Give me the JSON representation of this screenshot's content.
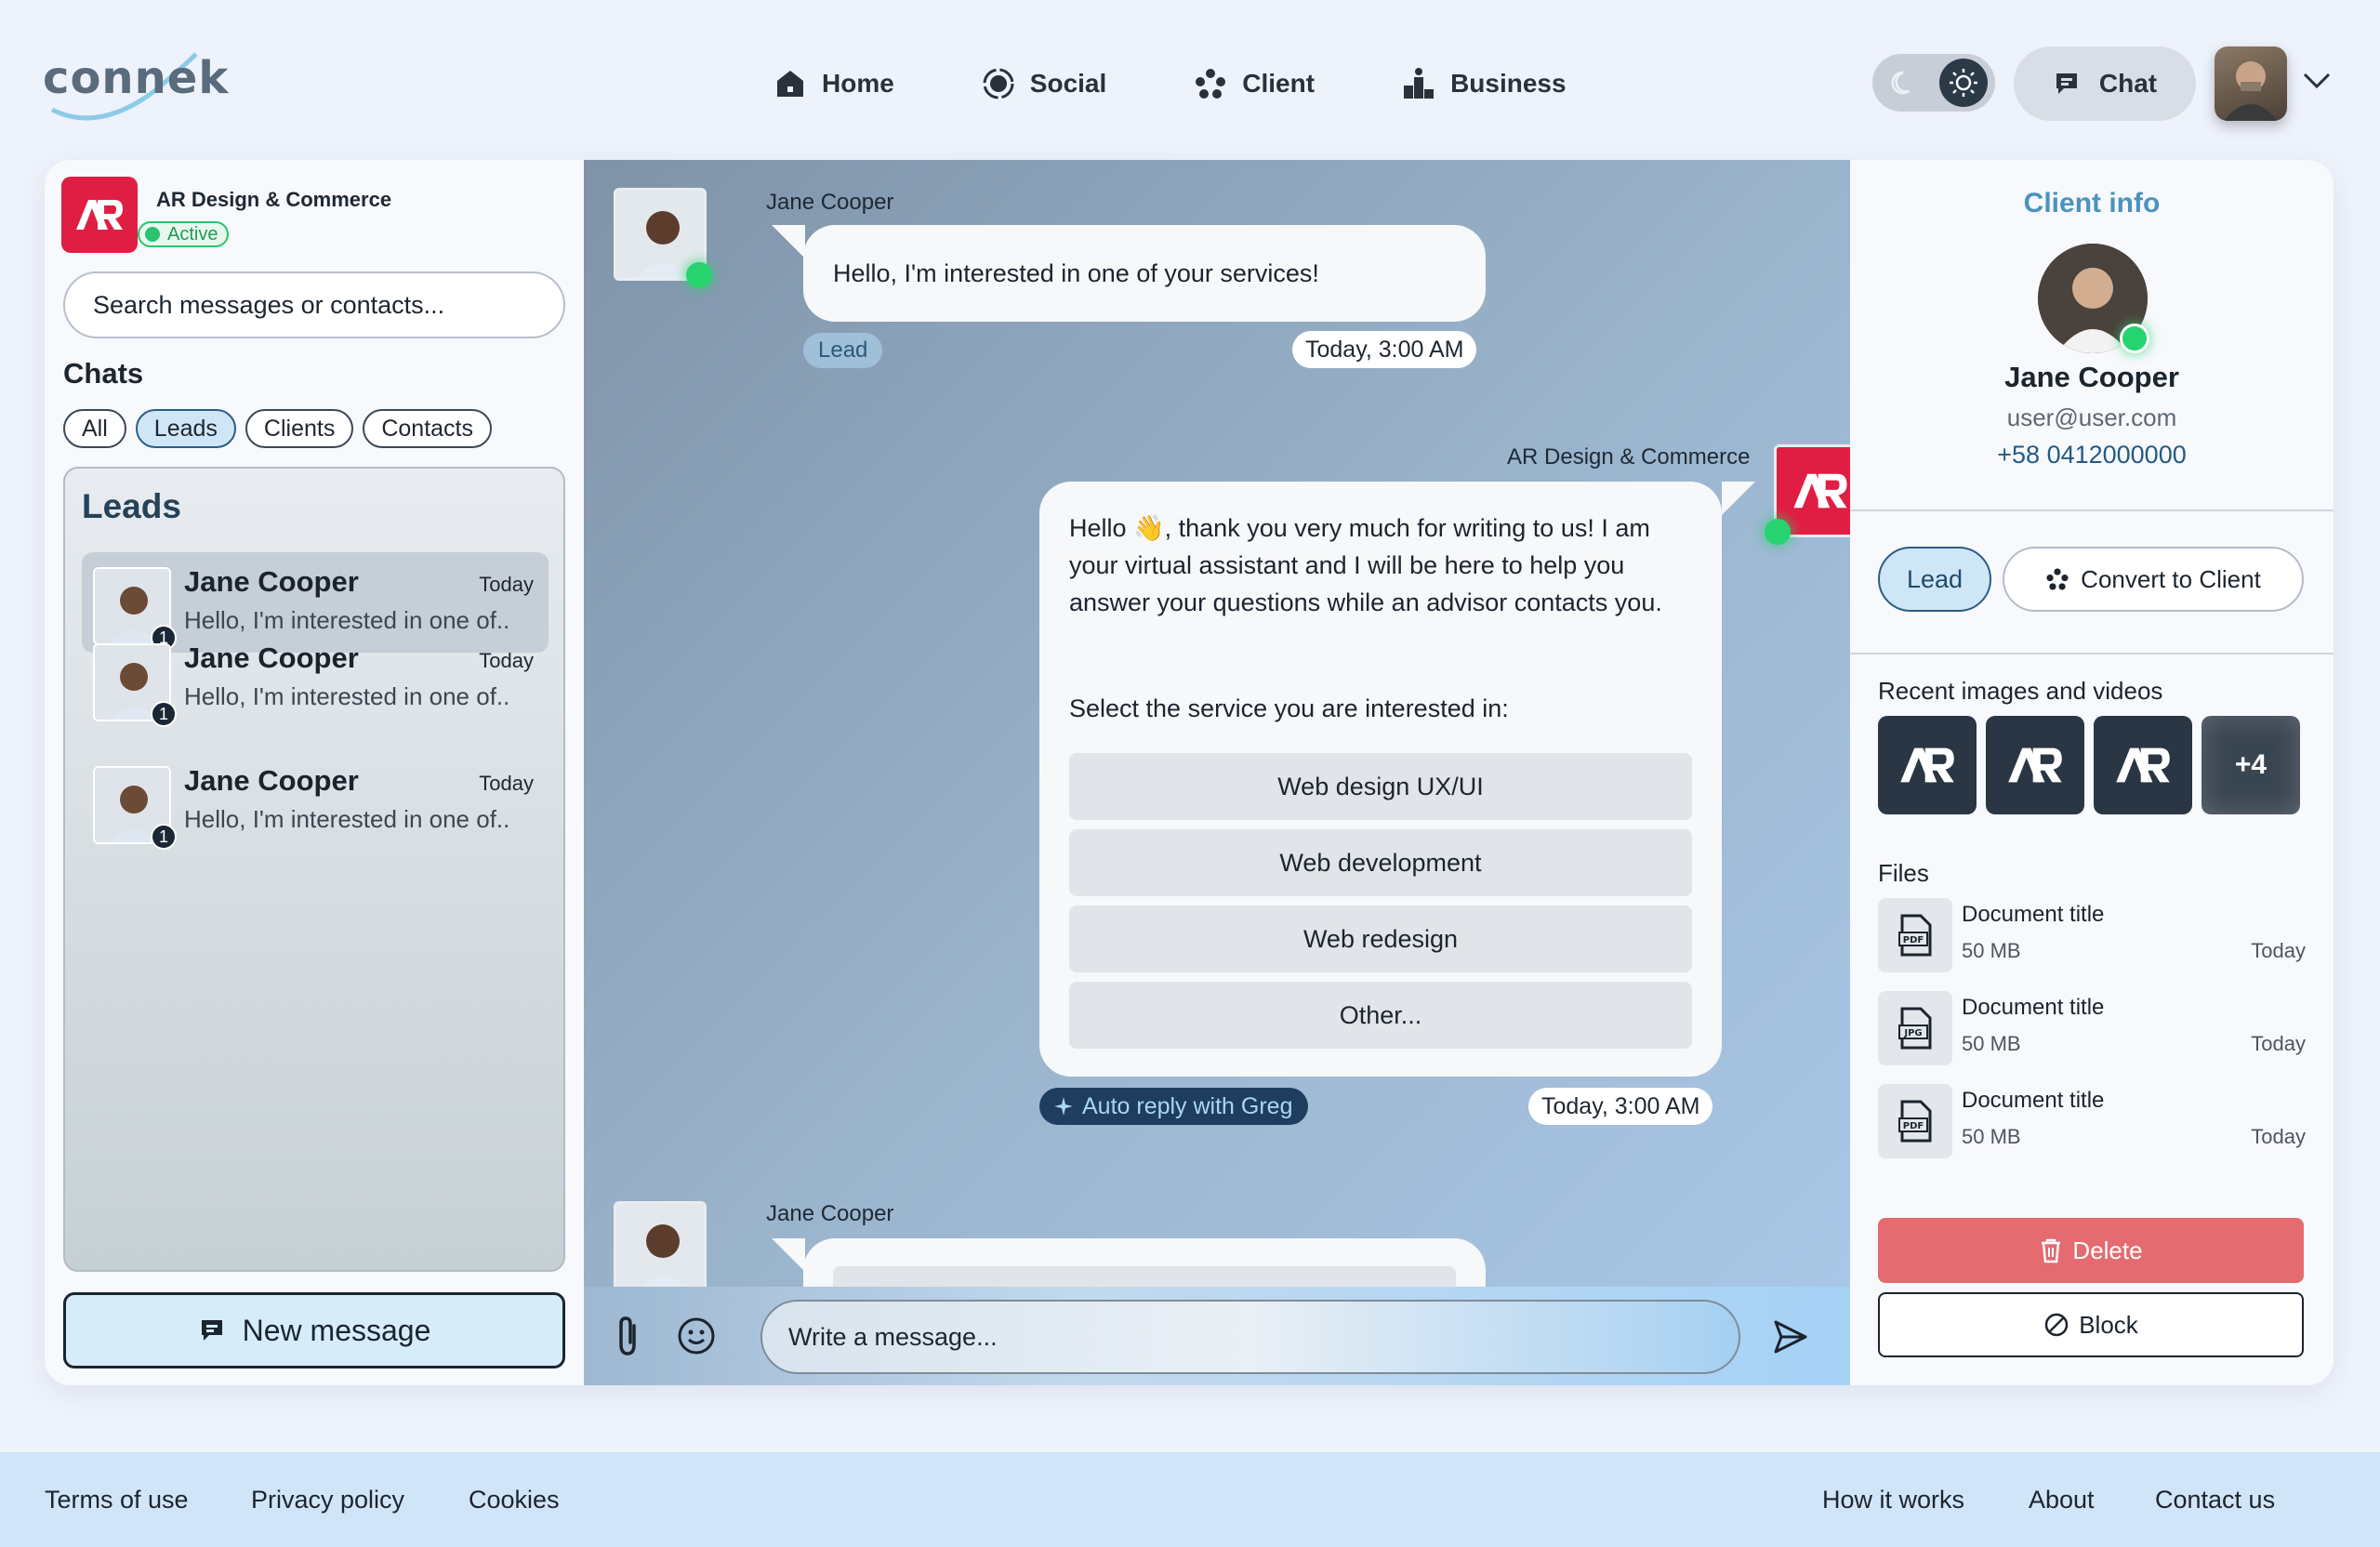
{
  "header": {
    "logo_text": "connek",
    "nav": [
      {
        "label": "Home",
        "icon": "home-icon"
      },
      {
        "label": "Social",
        "icon": "social-icon"
      },
      {
        "label": "Client",
        "icon": "client-icon"
      },
      {
        "label": "Business",
        "icon": "business-icon"
      }
    ],
    "chat_label": "Chat"
  },
  "sidebar": {
    "company_name": "AR Design & Commerce",
    "status": "Active",
    "search_placeholder": "Search messages or contacts...",
    "chats_title": "Chats",
    "filters": [
      "All",
      "Leads",
      "Clients",
      "Contacts"
    ],
    "active_filter": "Leads",
    "panel_title": "Leads",
    "items": [
      {
        "name": "Jane Cooper",
        "time": "Today",
        "preview": "Hello, I'm interested in one of..",
        "unread": "1"
      },
      {
        "name": "Jane Cooper",
        "time": "Today",
        "preview": "Hello, I'm interested in one of..",
        "unread": "1"
      },
      {
        "name": "Jane Cooper",
        "time": "Today",
        "preview": "Hello, I'm interested in one of..",
        "unread": "1"
      }
    ],
    "new_message_label": "New message"
  },
  "conversation": {
    "msg1": {
      "sender": "Jane Cooper",
      "text": "Hello, I'm interested in one of your services!",
      "tag": "Lead",
      "time": "Today, 3:00 AM"
    },
    "msg2": {
      "sender": "AR Design & Commerce",
      "text": "Hello 👋, thank you very much for writing to us! I am your virtual assistant and I will be here to help you answer your questions while an advisor contacts you.",
      "prompt": "Select the service you are interested in:",
      "options": [
        "Web design UX/UI",
        "Web development",
        "Web redesign",
        "Other..."
      ],
      "auto_reply": "Auto reply with Greg",
      "time": "Today, 3:00 AM"
    },
    "msg3": {
      "sender": "Jane Cooper"
    },
    "composer_placeholder": "Write a message..."
  },
  "client_info": {
    "title": "Client info",
    "name": "Jane Cooper",
    "email": "user@user.com",
    "phone": "+58 0412000000",
    "lead_label": "Lead",
    "convert_label": "Convert to Client",
    "media_title": "Recent images and videos",
    "media_more": "+4",
    "files_title": "Files",
    "files": [
      {
        "title": "Document title",
        "size": "50 MB",
        "date": "Today",
        "type": "PDF"
      },
      {
        "title": "Document title",
        "size": "50 MB",
        "date": "Today",
        "type": "JPG"
      },
      {
        "title": "Document title",
        "size": "50 MB",
        "date": "Today",
        "type": "PDF"
      }
    ],
    "delete_label": "Delete",
    "block_label": "Block"
  },
  "footer": {
    "left": [
      "Terms of use",
      "Privacy policy",
      "Cookies"
    ],
    "right": [
      "How it works",
      "About",
      "Contact us"
    ]
  },
  "colors": {
    "brand": "#e01e43",
    "accent": "#4a93bd",
    "online": "#27d36e",
    "delete": "#e46b70"
  }
}
